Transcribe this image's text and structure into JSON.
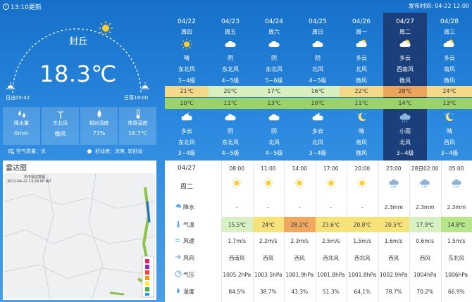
{
  "header": {
    "update_time": "13:10更新",
    "publish_label": "发布时间:",
    "publish_time": "04-22 12:00"
  },
  "current": {
    "city": "封丘",
    "temperature": "18.3℃",
    "sunrise": "日出05:42",
    "sunset": "日落19:00",
    "stats": [
      {
        "label": "降水量",
        "value": "0mm",
        "icon": "raindrops-icon"
      },
      {
        "label": "东北风",
        "value": "微风",
        "icon": "windmill-icon"
      },
      {
        "label": "相对湿度",
        "value": "71%",
        "icon": "humidity-icon"
      },
      {
        "label": "体感温度",
        "value": "16.7℃",
        "icon": "thermometer-icon"
      }
    ],
    "air_quality": "空气质量：优",
    "comfort": "舒适度：凉爽, 较舒适"
  },
  "radar": {
    "title": "雷达图",
    "map_title": "华中雷达拼图",
    "map_time": "2021-04-22 13:24:00 BJT"
  },
  "daily": [
    {
      "date": "04/22",
      "weekday": "周四",
      "day_cond": "晴",
      "day_wind": "东北风",
      "day_level": "3~4级",
      "high": "21℃",
      "low": "10℃",
      "night_cond": "多云",
      "night_wind": "东北风",
      "night_level": "3~4级",
      "day_icon": "sunny",
      "night_icon": "cloudy-moon"
    },
    {
      "date": "04/23",
      "weekday": "周五",
      "day_cond": "阴",
      "day_wind": "东北风",
      "day_level": "4~5级",
      "high": "20℃",
      "low": "11℃",
      "night_cond": "阴",
      "night_wind": "东北风",
      "night_level": "4~5级",
      "day_icon": "overcast",
      "night_icon": "overcast"
    },
    {
      "date": "04/24",
      "weekday": "周六",
      "day_cond": "阴",
      "day_wind": "东北风",
      "day_level": "5~6级",
      "high": "17℃",
      "low": "13℃",
      "night_cond": "阴",
      "night_wind": "北风",
      "night_level": "4~5级",
      "day_icon": "overcast",
      "night_icon": "overcast"
    },
    {
      "date": "04/25",
      "weekday": "周日",
      "day_cond": "阴",
      "day_wind": "北风",
      "day_level": "4~5级",
      "high": "16℃",
      "low": "10℃",
      "night_cond": "多云",
      "night_wind": "北风",
      "night_level": "3~4级",
      "day_icon": "overcast",
      "night_icon": "cloudy-moon"
    },
    {
      "date": "04/26",
      "weekday": "周一",
      "day_cond": "多云",
      "day_wind": "北风",
      "day_level": "微风",
      "high": "22℃",
      "low": "11℃",
      "night_cond": "晴",
      "night_wind": "南风",
      "night_level": "微风",
      "day_icon": "cloudy-sun",
      "night_icon": "moon"
    },
    {
      "date": "04/27",
      "weekday": "周二",
      "day_cond": "多云",
      "day_wind": "西南风",
      "day_level": "微风",
      "high": "28℃",
      "low": "14℃",
      "night_cond": "小雨",
      "night_wind": "北风",
      "night_level": "3~4级",
      "day_icon": "cloudy-sun",
      "night_icon": "rain"
    },
    {
      "date": "04/28",
      "weekday": "周三",
      "day_cond": "多云",
      "day_wind": "南风",
      "day_level": "微风",
      "high": "24℃",
      "low": "13℃",
      "night_cond": "晴",
      "night_wind": "西风",
      "night_level": "3~4级",
      "day_icon": "cloudy-sun",
      "night_icon": "moon"
    }
  ],
  "hourly": {
    "date": "04/27",
    "weekday": "周二",
    "times": [
      "08:00",
      "11:00",
      "14:00",
      "17:00",
      "20:00",
      "23:00",
      "28日02:00",
      "05:00"
    ],
    "icons": [
      "sunny",
      "sunny",
      "sunny",
      "sunny",
      "sunny",
      "rain",
      "rain",
      "rain"
    ],
    "labels": {
      "rain": "降水",
      "temp": "气温",
      "wind_speed": "风速",
      "wind_dir": "风向",
      "pressure": "气压",
      "humidity": "湿度"
    },
    "rain": [
      "-",
      "-",
      "-",
      "-",
      "-",
      "2.3mm",
      "2.3mm",
      "2.3mm"
    ],
    "temp": [
      "15.5℃",
      "24℃",
      "28.1℃",
      "23.6℃",
      "20.8℃",
      "20.5℃",
      "17.9℃",
      "14.8℃"
    ],
    "temp_colors": [
      "#d7f0c4",
      "#f7e27a",
      "#f0a860",
      "#f7e27a",
      "#f7e27a",
      "#f7e27a",
      "#d7f0c4",
      "#b6e58a"
    ],
    "wind_speed": [
      "1.7m/s",
      "2.2m/s",
      "2.3m/s",
      "2.5m/s",
      "1.5m/s",
      "1.6m/s",
      "0.6m/s",
      "1.5m/s"
    ],
    "wind_dir": [
      "西南风",
      "西风",
      "西风",
      "西北风",
      "西北风",
      "西风",
      "西风",
      "东北风"
    ],
    "pressure": [
      "1005.2hPa",
      "1003.5hPa",
      "1001.9hPa",
      "1001.8hPa",
      "1001.8hPa",
      "1002.9hPa",
      "1004hPa",
      "1006hPa"
    ],
    "humidity": [
      "84.5%",
      "38.7%",
      "43.3%",
      "51.3%",
      "64.1%",
      "78.7%",
      "70.2%",
      "66.9%"
    ]
  },
  "colors": {
    "high_default": "#d8f0c0",
    "high_warm": "#f5d98a",
    "high_hot": "#eba55c",
    "low": "#9ad36a",
    "highlight_column": "#1a3f7a"
  }
}
